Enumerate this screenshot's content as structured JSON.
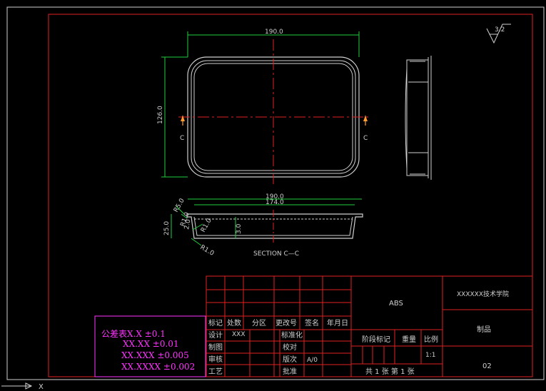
{
  "drawing": {
    "dims": {
      "top_width": "190.0",
      "left_height": "126.0",
      "section_width_outer": "190.0",
      "section_width_inner": "174.0",
      "depth": "25.0",
      "rim": "3.0",
      "r1": "R5.0",
      "r2": "R1.0",
      "r3": "R1.0",
      "r4": "R1.0",
      "angle": "2.0"
    },
    "section_mark": "C",
    "section_label": "SECTION C—C",
    "roughness": "3.2"
  },
  "tolerance": {
    "title": "公差表",
    "lines": [
      "X.X ±0.1",
      "XX.XX ±0.01",
      "XX.XXX ±0.005",
      "XX.XXXX ±0.002"
    ]
  },
  "titleblock": {
    "header": [
      "标记",
      "处数",
      "分区",
      "更改号",
      "签名",
      "年月日"
    ],
    "row_design": "设计",
    "designer": "XXX",
    "std": "标准化",
    "row_draw": "制图",
    "check": "校对",
    "row_review": "审核",
    "version_label": "版次",
    "version": "A/0",
    "row_process": "工艺",
    "approve": "批准",
    "material": "ABS",
    "stage_label": "阶段标记",
    "weight_label": "重量",
    "scale_label": "比例",
    "scale": "1:1",
    "sheets": "共 1 张   第 1 张",
    "school": "XXXXXX技术学院",
    "part_name": "制品",
    "drawing_no": "02"
  },
  "cursor": "X"
}
